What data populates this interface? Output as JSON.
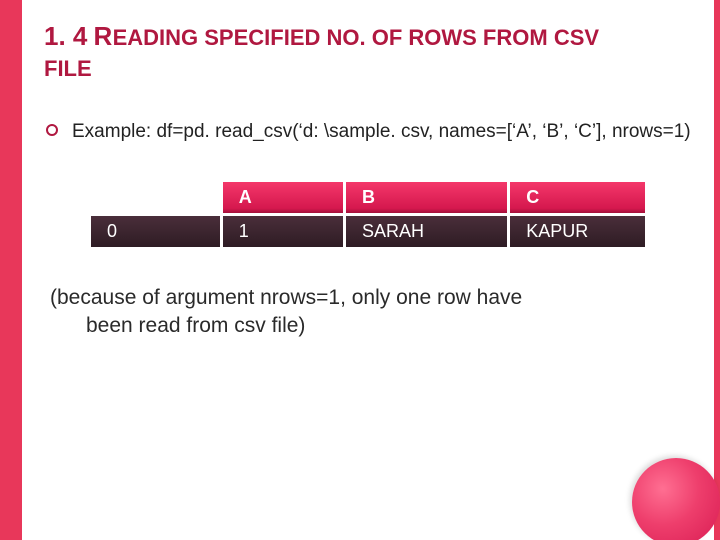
{
  "heading": {
    "number": "1. 4",
    "lead_cap": "R",
    "rest_upper": "EADING SPECIFIED NO. OF ROWS FROM CSV ",
    "second_line": "FILE"
  },
  "bullet": {
    "text": "Example: df=pd. read_csv(‘d: \\sample. csv, names=[‘A’, ‘B’, ‘C’], nrows=1)"
  },
  "chart_data": {
    "type": "table",
    "columns": [
      "A",
      "B",
      "C"
    ],
    "index": [
      "0"
    ],
    "rows": [
      [
        "1",
        "SARAH",
        "KAPUR"
      ]
    ]
  },
  "note": {
    "line1": "(because of argument nrows=1, only one row have",
    "line2": "been read from csv file)"
  },
  "colors": {
    "accent": "#e8375a",
    "heading": "#b01840"
  }
}
